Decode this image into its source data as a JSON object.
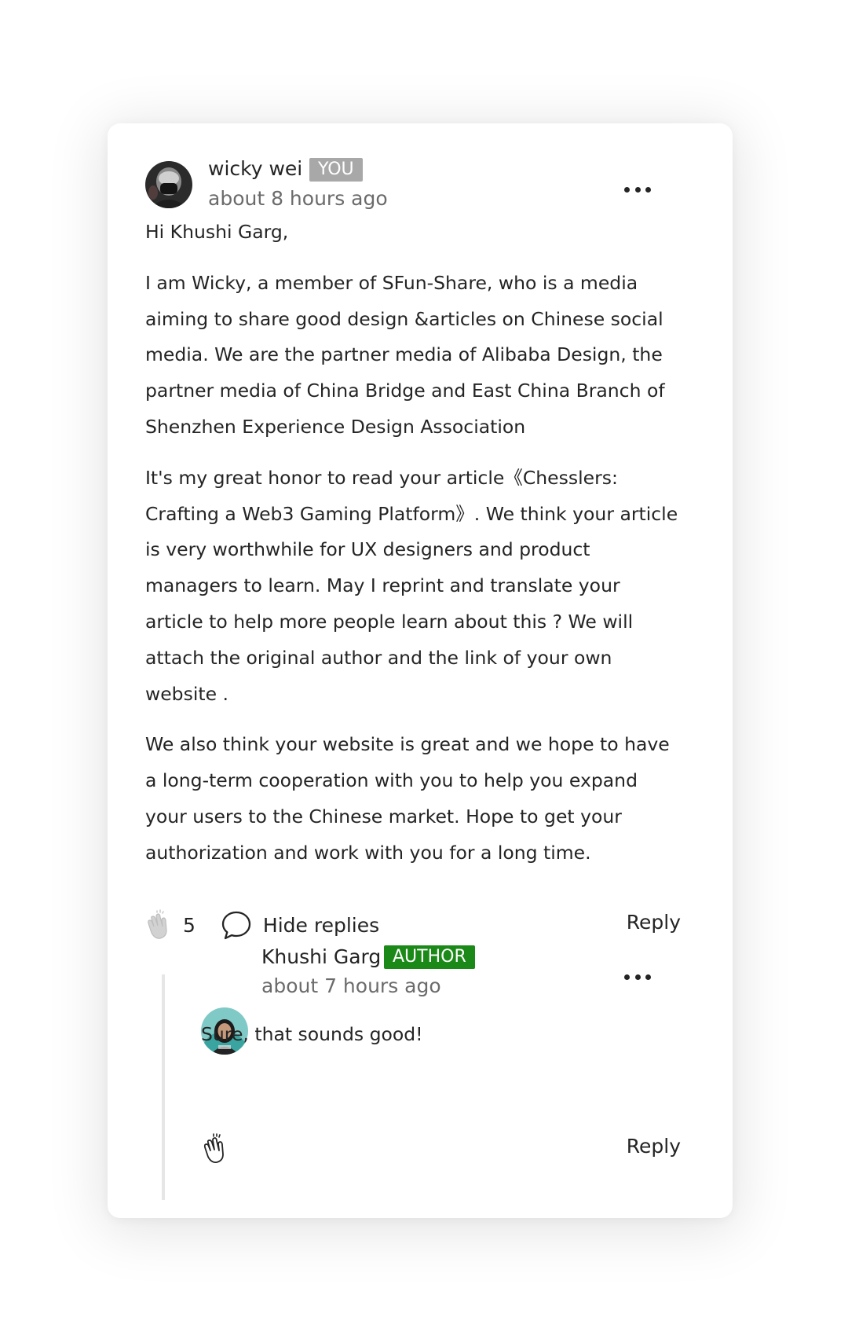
{
  "comment": {
    "author_name": "wicky wei",
    "author_badge": "YOU",
    "timestamp": "about 8 hours ago",
    "greeting": "Hi Khushi Garg,",
    "paragraph_1": "I am Wicky, a member of SFun-Share, who is a media aiming to share good design &articles on Chinese social media. We are the partner media of Alibaba Design, the partner media of China Bridge and East China Branch of Shenzhen Experience Design Association",
    "paragraph_2": "It's my great honor to read your article《Chesslers: Crafting a Web3 Gaming Platform》. We think your article is very worthwhile for UX designers and product managers to learn. May I reprint and translate your article to help more people learn about this ? We will attach the original author and the link of your own website .",
    "paragraph_3": "We also think your website is great and we hope to have a long-term cooperation with you to help you expand your users to the Chinese market. Hope to get your authorization and work with you for a long time.",
    "clap_count": "5",
    "hide_replies_label": "Hide replies",
    "reply_label": "Reply",
    "badge_color": "#a8a8a8"
  },
  "reply": {
    "author_name": "Khushi Garg",
    "author_badge": "AUTHOR",
    "timestamp": "about 7 hours ago",
    "text": "Sure, that sounds good!",
    "reply_label": "Reply",
    "badge_color": "#1a8917"
  },
  "icons": {
    "more": "more-horizontal-icon",
    "clap": "clap-icon",
    "response": "speech-bubble-icon"
  }
}
